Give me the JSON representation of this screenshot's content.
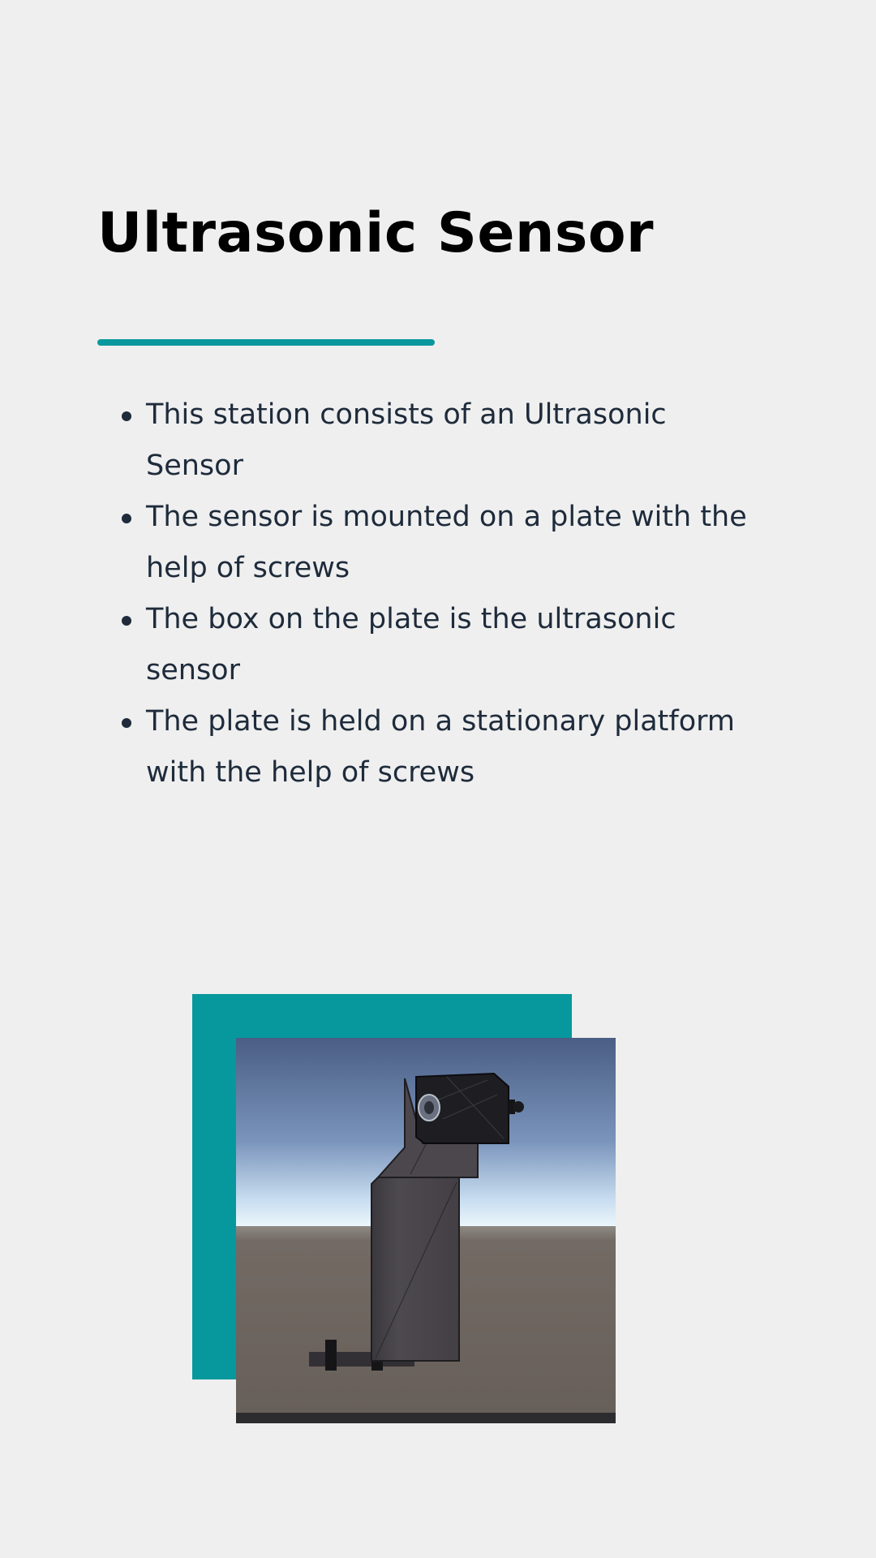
{
  "slide": {
    "title": "Ultrasonic Sensor",
    "accent_color": "#0a989e",
    "bullets": [
      "This station consists of an Ultrasonic Sensor",
      "The sensor is mounted on a plate with the help of screws",
      "The box on the plate is the ultrasonic sensor",
      "The plate is held on a stationary platform with the help of screws"
    ]
  },
  "figure": {
    "backdrop_color": "#07989d",
    "image": "ultrasonic-sensor-mount-render"
  }
}
